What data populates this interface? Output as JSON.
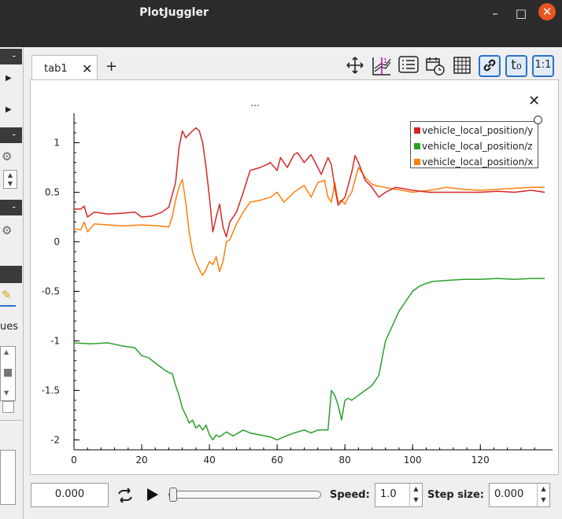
{
  "window": {
    "title": "PlotJuggler",
    "minimize": "–",
    "maximize": "□",
    "close": "✕"
  },
  "left_panel": {
    "label_values": "ues"
  },
  "tabs": {
    "active": "tab1",
    "close": "✕",
    "add": "+"
  },
  "toolbar": {
    "icons": [
      "move-icon",
      "grid-lines-icon",
      "legend-list-icon",
      "datetime-icon",
      "grid-icon",
      "link-icon",
      "t0-icon",
      "ratio-icon"
    ],
    "t0_label": "t₀",
    "ratio_label": "1:1"
  },
  "plot": {
    "title": "...",
    "close": "✕"
  },
  "controls": {
    "time_value": "0.000",
    "speed_label": "Speed:",
    "speed_value": "1.0",
    "step_label": "Step size:",
    "step_value": "0.000"
  },
  "chart_data": {
    "type": "line",
    "title": "...",
    "xlabel": "",
    "ylabel": "",
    "xlim": [
      0,
      139
    ],
    "ylim": [
      -2.1,
      1.25
    ],
    "x_ticks": [
      0,
      20,
      40,
      60,
      80,
      100,
      120
    ],
    "y_ticks": [
      1,
      0.5,
      0,
      -0.5,
      -1,
      -1.5,
      -2
    ],
    "x_tick_labels": [
      "0",
      "20",
      "40",
      "60",
      "80",
      "100",
      "120"
    ],
    "y_tick_labels": [
      "1",
      "0.5",
      "0",
      "-0.5",
      "-1",
      "-1.5",
      "-2"
    ],
    "grid": false,
    "legend_position": "top-right",
    "series": [
      {
        "name": "vehicle_local_position/y",
        "color": "#d62728",
        "x": [
          0,
          2,
          3,
          4,
          6,
          10,
          15,
          18,
          20,
          23,
          26,
          28,
          30,
          31,
          32,
          33,
          35,
          36,
          37,
          38,
          39,
          40,
          41,
          42,
          43,
          44,
          45,
          46,
          48,
          50,
          52,
          55,
          57,
          58,
          60,
          61,
          63,
          65,
          66,
          68,
          70,
          72,
          73,
          75,
          76,
          77,
          78,
          80,
          82,
          83,
          84,
          86,
          88,
          90,
          92,
          95,
          100,
          105,
          110,
          115,
          120,
          125,
          130,
          135,
          139
        ],
        "y": [
          0.33,
          0.33,
          0.36,
          0.25,
          0.3,
          0.28,
          0.29,
          0.3,
          0.25,
          0.26,
          0.3,
          0.35,
          0.6,
          0.95,
          1.12,
          1.05,
          1.12,
          1.15,
          1.12,
          1.0,
          0.75,
          0.45,
          0.1,
          0.25,
          0.38,
          0.15,
          0.05,
          0.2,
          0.3,
          0.5,
          0.72,
          0.75,
          0.78,
          0.8,
          0.72,
          0.85,
          0.75,
          0.88,
          0.9,
          0.8,
          0.88,
          0.75,
          0.68,
          0.85,
          0.78,
          0.55,
          0.37,
          0.45,
          0.7,
          0.87,
          0.8,
          0.62,
          0.55,
          0.45,
          0.5,
          0.55,
          0.52,
          0.5,
          0.5,
          0.5,
          0.5,
          0.51,
          0.5,
          0.52,
          0.5
        ]
      },
      {
        "name": "vehicle_local_position/z",
        "color": "#2ca02c",
        "x": [
          0,
          5,
          10,
          14,
          18,
          20,
          22,
          25,
          27,
          28,
          29,
          30,
          31,
          32,
          33,
          34,
          35,
          36,
          37,
          38,
          39,
          40,
          41,
          42,
          43,
          45,
          47,
          50,
          52,
          55,
          58,
          60,
          62,
          65,
          68,
          70,
          72,
          74,
          75,
          76,
          77,
          78,
          79,
          80,
          81,
          82,
          84,
          86,
          88,
          90,
          92,
          94,
          96,
          98,
          100,
          102,
          104,
          106,
          110,
          115,
          120,
          125,
          130,
          135,
          139
        ],
        "y": [
          -1.02,
          -1.03,
          -1.02,
          -1.05,
          -1.07,
          -1.15,
          -1.17,
          -1.25,
          -1.3,
          -1.32,
          -1.33,
          -1.45,
          -1.55,
          -1.68,
          -1.75,
          -1.83,
          -1.8,
          -1.88,
          -1.85,
          -1.9,
          -1.85,
          -1.95,
          -2.0,
          -1.95,
          -1.97,
          -1.92,
          -1.96,
          -1.9,
          -1.93,
          -1.95,
          -1.97,
          -2.0,
          -1.97,
          -1.93,
          -1.9,
          -1.93,
          -1.9,
          -1.9,
          -1.9,
          -1.5,
          -1.55,
          -1.65,
          -1.8,
          -1.6,
          -1.58,
          -1.6,
          -1.55,
          -1.5,
          -1.45,
          -1.35,
          -1.0,
          -0.85,
          -0.7,
          -0.6,
          -0.5,
          -0.45,
          -0.42,
          -0.4,
          -0.39,
          -0.38,
          -0.38,
          -0.37,
          -0.38,
          -0.37,
          -0.37
        ]
      },
      {
        "name": "vehicle_local_position/x",
        "color": "#ff7f0e",
        "x": [
          0,
          2,
          3,
          4,
          6,
          10,
          15,
          20,
          25,
          28,
          29,
          30,
          31,
          32,
          33,
          34,
          35,
          36,
          37,
          38,
          39,
          40,
          41,
          42,
          43,
          44,
          45,
          46,
          48,
          50,
          52,
          55,
          58,
          60,
          62,
          65,
          68,
          70,
          72,
          74,
          75,
          76,
          77,
          78,
          79,
          80,
          81,
          82,
          84,
          86,
          88,
          90,
          95,
          100,
          105,
          110,
          115,
          120,
          125,
          130,
          135,
          139
        ],
        "y": [
          0.13,
          0.12,
          0.2,
          0.1,
          0.18,
          0.17,
          0.16,
          0.17,
          0.16,
          0.15,
          0.25,
          0.42,
          0.55,
          0.63,
          0.4,
          0.1,
          -0.1,
          -0.2,
          -0.28,
          -0.34,
          -0.28,
          -0.2,
          -0.23,
          -0.15,
          -0.3,
          -0.2,
          0.0,
          0.02,
          0.18,
          0.3,
          0.4,
          0.42,
          0.45,
          0.5,
          0.4,
          0.5,
          0.57,
          0.45,
          0.6,
          0.62,
          0.45,
          0.4,
          0.6,
          0.4,
          0.42,
          0.38,
          0.45,
          0.5,
          0.75,
          0.65,
          0.58,
          0.56,
          0.53,
          0.5,
          0.52,
          0.55,
          0.53,
          0.52,
          0.53,
          0.54,
          0.55,
          0.55
        ]
      }
    ]
  }
}
